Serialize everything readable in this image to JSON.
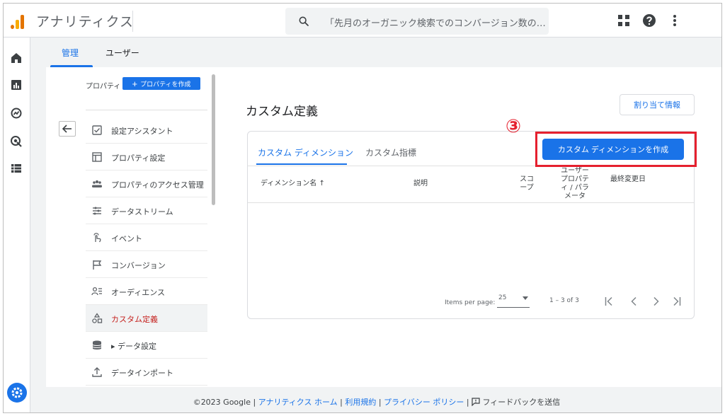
{
  "app": {
    "title": "アナリティクス"
  },
  "search": {
    "placeholder": "「先月のオーガニック検索でのコンバージョン数の…"
  },
  "top_tabs": [
    {
      "label": "管理",
      "active": true
    },
    {
      "label": "ユーザー",
      "active": false
    }
  ],
  "property": {
    "label": "プロパティ",
    "create_button": "プロパティを作成"
  },
  "nav_items": [
    {
      "label": "設定アシスタント",
      "icon": "checkbox-icon"
    },
    {
      "label": "プロパティ設定",
      "icon": "layout-icon"
    },
    {
      "label": "プロパティのアクセス管理",
      "icon": "people-icon"
    },
    {
      "label": "データストリーム",
      "icon": "streams-icon"
    },
    {
      "label": "イベント",
      "icon": "touch-icon"
    },
    {
      "label": "コンバージョン",
      "icon": "flag-icon"
    },
    {
      "label": "オーディエンス",
      "icon": "audience-icon"
    },
    {
      "label": "カスタム定義",
      "icon": "shapes-icon",
      "active": true
    },
    {
      "label": "データ設定",
      "icon": "database-icon",
      "expander": "▸"
    },
    {
      "label": "データインポート",
      "icon": "upload-icon"
    }
  ],
  "main": {
    "title": "カスタム定義",
    "assign_button": "割り当て情報",
    "step_marker": "③",
    "tabs": [
      {
        "label": "カスタム ディメンション",
        "active": true
      },
      {
        "label": "カスタム指標",
        "active": false
      }
    ],
    "create_button": "カスタム ディメンションを作成",
    "columns": [
      {
        "label": "ディメンション名 ↑"
      },
      {
        "label": "説明"
      },
      {
        "label": "スコープ"
      },
      {
        "label": "ユーザープロパティ / パラメータ"
      },
      {
        "label": "最終変更日"
      }
    ],
    "rows": []
  },
  "pagination": {
    "items_per_page_label": "Items per page:",
    "items_per_page": "25",
    "range": "1 – 3 of 3"
  },
  "footer": {
    "copyright": "©2023 Google |",
    "links": [
      "アナリティクス ホーム",
      "利用規約",
      "プライバシー ポリシー"
    ],
    "feedback": "フィードバックを送信"
  },
  "colors": {
    "accent": "#1a73e8",
    "highlight": "#e5202e",
    "active_nav_text": "#c5221f"
  }
}
